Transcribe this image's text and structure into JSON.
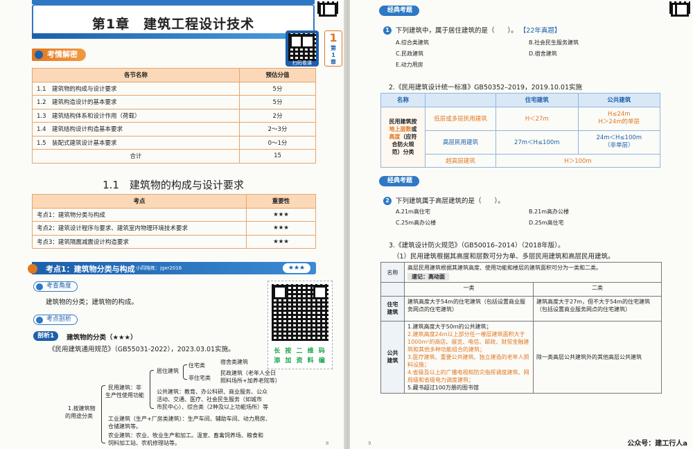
{
  "left": {
    "chapter_title": "第1章　建筑工程设计技术",
    "tab": {
      "num": "1",
      "line1": "第",
      "line2": "1",
      "line3": "章"
    },
    "qr_small_label": "扫码看课",
    "section1_tag": "考情解密",
    "table1": {
      "headers": [
        "各节名称",
        "预估分值"
      ],
      "rows": [
        [
          "1.1　建筑物的构成与设计要求",
          "5分"
        ],
        [
          "1.2　建筑构造设计的基本要求",
          "5分"
        ],
        [
          "1.3　建筑结构体系和设计作用（荷载）",
          "2分"
        ],
        [
          "1.4　建筑结构设计构造基本要求",
          "2～3分"
        ],
        [
          "1.5　装配式建筑设计基本要求",
          "0～1分"
        ]
      ],
      "total_label": "合计",
      "total_value": "15"
    },
    "section_heading": "1.1　建筑物的构成与设计要求",
    "table2": {
      "headers": [
        "考点",
        "重要性"
      ],
      "rows": [
        [
          "考点1：建筑物分类与构成",
          "★★★"
        ],
        [
          "考点2：建筑设计程序与要求、建筑室内物理环境技术要求",
          "★★★"
        ],
        [
          "考点3：建筑隔震减震设计构造要求",
          "★★★"
        ]
      ]
    },
    "kd_bar": {
      "title": "考点1：建筑物分类与构成",
      "sub": "小四陪练：jgxr2016",
      "stars": "★★★"
    },
    "pill1": "考查角度",
    "angle_text": "建筑物的分类；建筑物的构成。",
    "pill2": "考点剖析",
    "analysis_tag": "剖析1",
    "analysis_title": "建筑物的分类（★★★）",
    "code_ref": "《民用建筑通用规范》（GB55031-2022），2023.03.01实施。",
    "qr_caption_1": "长 按 二 维 码",
    "qr_caption_2": "添 加 资 料 编",
    "tree": {
      "root": "1.按建筑物",
      "root2": "的用途分类",
      "civil": "民用建筑：非",
      "civil2": "生产性使用功能",
      "residential": "居住建筑",
      "dwelling": "住宅类",
      "dorm": "宿舍类建筑",
      "non_dwelling": "非住宅类",
      "non_dwelling_desc": "民政建筑（老年人全日",
      "non_dwelling_desc2": "照料场所+加养老院等）",
      "public1": "公共建筑：教育、办公科研、商业服务、公众",
      "public2": "活动、交通、医疗、社会民生服务（如城市",
      "public3": "市民中心）、综合类（2种及以上功能场所）等",
      "industrial1": "工业建筑（生产+厂房类建筑）：生产车间、辅助车间、动力用房、",
      "industrial2": "仓储建筑等。",
      "agri1": "农业建筑：农业、牧业生产和加工。温室、畜禽饲养场、粮食和",
      "agri2": "饲料加工站、农机修理站等。"
    },
    "page_no": "8"
  },
  "right": {
    "eg_tag1": "经典考题",
    "q1": {
      "num": "1",
      "stem": "下列建筑中，属于居住建筑的是（　　）。",
      "tag": "【22年真题】",
      "options": [
        "A.综合类建筑",
        "B.社会民生服务建筑",
        "C.民政建筑",
        "D.宿舍建筑",
        "E.动力用房"
      ]
    },
    "ref2": "2.《民用建筑设计统一标准》GB50352–2019，2019.10.01实施",
    "table3": {
      "headers": [
        "名称",
        "住宅建筑",
        "公共建筑"
      ],
      "row_label_1": "民用建筑按",
      "row_label_2": "地上层数",
      "row_label_3": "或",
      "row_label_4": "高度",
      "row_label_5": "（应符",
      "row_label_6": "合防火规",
      "row_label_7": "范）分类",
      "r1c1": "低层或多层民用建筑",
      "r1c2": "H＜27m",
      "r1c3a": "H≤24m",
      "r1c3b": "H＞24m的单层",
      "r2c1": "高层民用建筑",
      "r2c2": "27m＜H≤100m",
      "r2c3a": "24m＜H≤100m",
      "r2c3b": "（非单层）",
      "r3c1": "超高层建筑",
      "r3c2": "H＞100m"
    },
    "eg_tag2": "经典考题",
    "q2": {
      "num": "2",
      "stem": "下列建筑属于高层建筑的是（　　）。",
      "options": [
        "A.21m高住宅",
        "B.21m高办公楼",
        "C.25m高办公楼",
        "D.25m高住宅"
      ]
    },
    "ref3": "3.《建筑设计防火规范》（GB50016–2014）（2018年版）。",
    "ref3_sub": "（1）民用建筑根据其高度和层数可分为单、多层民用建筑和高层民用建筑。",
    "table4": {
      "name_label": "名称",
      "intro": "高层民用建筑根据其建筑高度、使用功能和楼层的建筑面积可分为一类和二类。",
      "note": "速记：高动面",
      "col1": "一类",
      "col2": "二类",
      "res_label_1": "住宅",
      "res_label_2": "建筑",
      "res1": "建筑高度大于54m的住宅建筑（包括设置商业服务网点的住宅建筑）",
      "res2": "建筑高度大于27m，但不大于54m的住宅建筑（包括设置商业服务网点的住宅建筑）",
      "pub_label_1": "公共",
      "pub_label_2": "建筑",
      "pub_items": [
        "1.建筑高度大于50m的公共建筑；",
        "2.建筑高度24m以上部分任一楼层建筑面积大于1000m²的商店、展览、电信、邮政、财贸金融建筑和其他多种功能组合的建筑；",
        "3.医疗建筑、重要公共建筑、独立建造的老年人照料设施；",
        "4.省级及以上的广播电视和防灾指挥调度建筑、网局级和省级电力调度建筑；",
        "5.藏书超过100万册的图书馆"
      ],
      "pub2": "除一类高层公共建筑外的其他高层公共建筑"
    },
    "page_no": "9",
    "footer": "公众号：建工行人a"
  }
}
